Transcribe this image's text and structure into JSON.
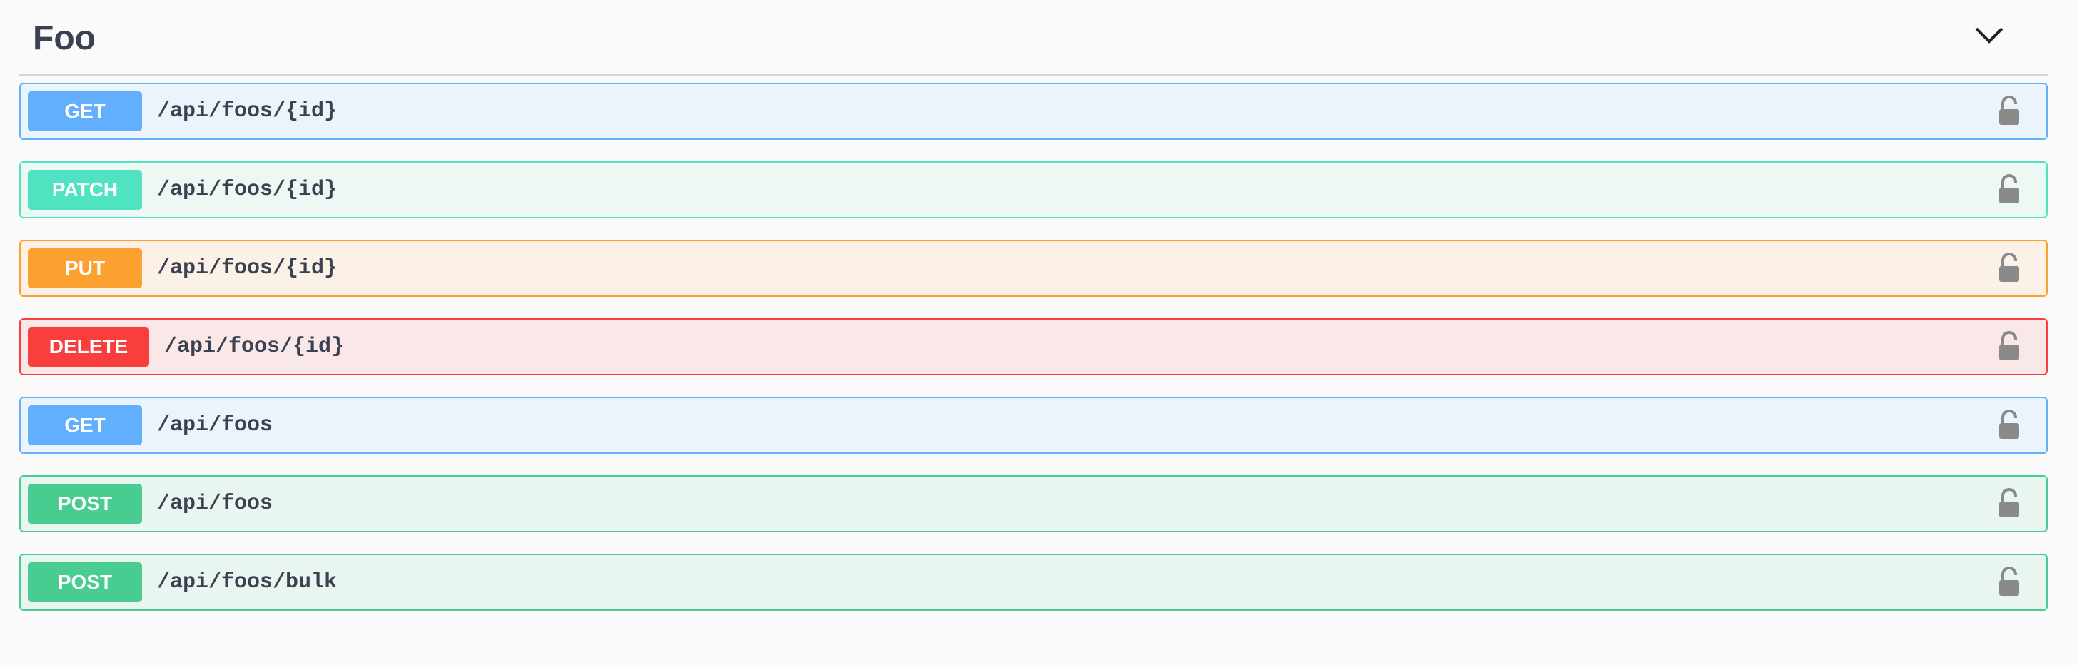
{
  "section": {
    "title": "Foo",
    "expanded_icon": "chevron-down-icon"
  },
  "operations": [
    {
      "method": "GET",
      "path": "/api/foos/{id}",
      "color": "#61affe",
      "border": "#61affe",
      "bg": "#ebf3fb",
      "icon": "lock-open-icon"
    },
    {
      "method": "PATCH",
      "path": "/api/foos/{id}",
      "color": "#50e3c2",
      "border": "#50e3c2",
      "bg": "#edf8f5",
      "icon": "lock-open-icon"
    },
    {
      "method": "PUT",
      "path": "/api/foos/{id}",
      "color": "#fca130",
      "border": "#fca130",
      "bg": "#fbf1e6",
      "icon": "lock-open-icon"
    },
    {
      "method": "DELETE",
      "path": "/api/foos/{id}",
      "color": "#f93e3e",
      "border": "#f93e3e",
      "bg": "#fae7e7",
      "icon": "lock-open-icon"
    },
    {
      "method": "GET",
      "path": "/api/foos",
      "color": "#61affe",
      "border": "#61affe",
      "bg": "#ebf3fb",
      "icon": "lock-open-icon"
    },
    {
      "method": "POST",
      "path": "/api/foos",
      "color": "#49cc90",
      "border": "#49cc90",
      "bg": "#e9f6f0",
      "icon": "lock-open-icon"
    },
    {
      "method": "POST",
      "path": "/api/foos/bulk",
      "color": "#49cc90",
      "border": "#49cc90",
      "bg": "#e9f6f0",
      "icon": "lock-open-icon"
    }
  ]
}
